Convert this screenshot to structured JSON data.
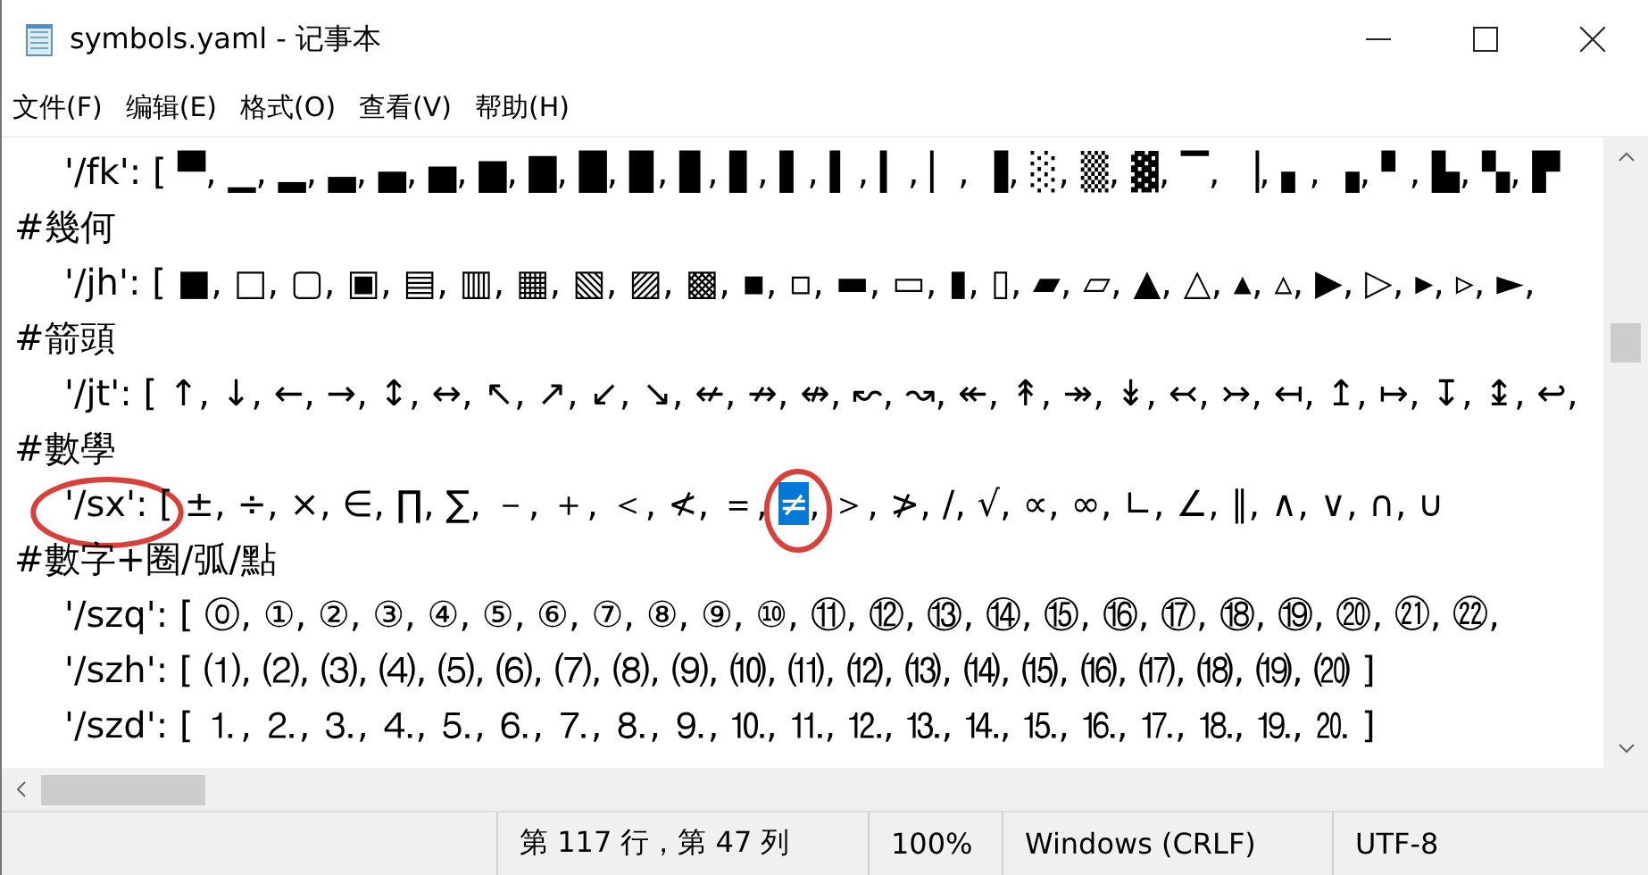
{
  "window": {
    "title": "symbols.yaml - 记事本"
  },
  "menu": [
    {
      "label": "文件(F)"
    },
    {
      "label": "编辑(E)"
    },
    {
      "label": "格式(O)"
    },
    {
      "label": "查看(V)"
    },
    {
      "label": "帮助(H)"
    }
  ],
  "lines": [
    {
      "kind": "entry",
      "key": "'/fk':",
      "text": " [ ▀, ▁, ▂, ▃, ▄, ▅, ▆, ▇, █, ▉, ▊, ▋, ▌, ▍, ▎, ▏, ▐, ░, ▒, ▓, ▔, ▕, ▖, ▗, ▘, ▙, ▚, ▛"
    },
    {
      "kind": "comment",
      "text": "#幾何"
    },
    {
      "kind": "entry",
      "key": "'/jh':",
      "text": " [ ■, □, ▢, ▣, ▤, ▥, ▦, ▧, ▨, ▩, ▪, ▫, ▬, ▭, ▮, ▯, ▰, ▱, ▲, △, ▴, ▵, ▶, ▷, ▸, ▹, ►,"
    },
    {
      "kind": "comment",
      "text": "#箭頭"
    },
    {
      "kind": "entry",
      "key": "'/jt':",
      "text": " [ ↑, ↓, ←, →, ↕, ↔, ↖, ↗, ↙, ↘, ↚, ↛, ↮, ↜, ↝, ↞, ↟, ↠, ↡, ↢, ↣, ↤, ↥, ↦, ↧, ↨, ↩,"
    },
    {
      "kind": "comment",
      "text": "#數學"
    },
    {
      "kind": "entry",
      "key": "'/sx':",
      "key_circled": true,
      "text": " [ ±, ÷, ×, ∈, ∏, ∑, －, ＋, ＜, ≮, ＝, ",
      "selected": "≠",
      "selected_circled": true,
      "after": ", ＞, ≯, ∕, √, ∝, ∞, ∟, ∠, ∥, ∧, ∨, ∩, ∪"
    },
    {
      "kind": "comment",
      "text": "#數字+圈/弧/點"
    },
    {
      "kind": "entry",
      "key": "'/szq':",
      "text": " [ ⓪, ①, ②, ③, ④, ⑤, ⑥, ⑦, ⑧, ⑨, ⑩, ⑪, ⑫, ⑬, ⑭, ⑮, ⑯, ⑰, ⑱, ⑲, ⑳, ㉑, ㉒,"
    },
    {
      "kind": "entry",
      "key": "'/szh':",
      "text": " [ ⑴, ⑵, ⑶, ⑷, ⑸, ⑹, ⑺, ⑻, ⑼, ⑽, ⑾, ⑿, ⒀, ⒁, ⒂, ⒃, ⒄, ⒅, ⒆, ⒇ ]"
    },
    {
      "kind": "entry",
      "key": "'/szd':",
      "text": " [ ⒈, ⒉, ⒊, ⒋, ⒌, ⒍, ⒎, ⒏, ⒐, ⒑, ⒒, ⒓, ⒔, ⒕, ⒖, ⒗, ⒘, ⒙, ⒚, ⒛ ]"
    }
  ],
  "status_bar": {
    "position": "第 117 行，第 47 列",
    "zoom": "100%",
    "line_ending": "Windows (CRLF)",
    "encoding": "UTF-8"
  }
}
